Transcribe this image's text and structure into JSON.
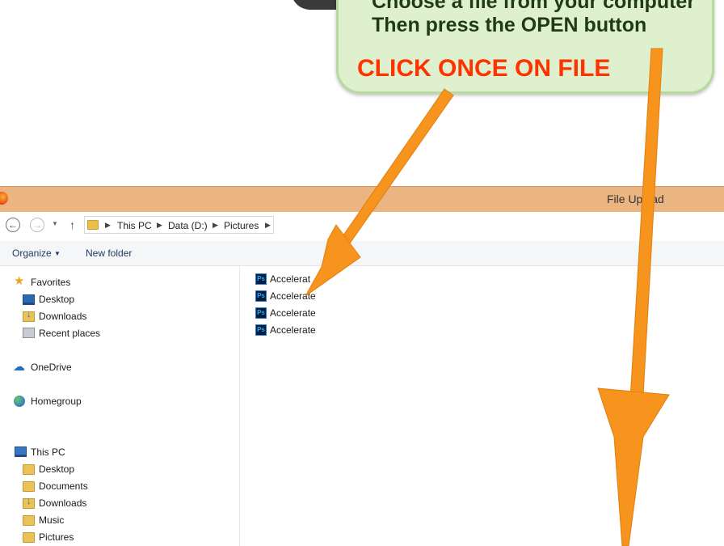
{
  "callout": {
    "line1": "Choose a file from your computer",
    "line2": "Then press the OPEN button",
    "click_text": "CLICK ONCE ON FILE"
  },
  "window": {
    "title": "File Upload"
  },
  "address": {
    "crumbs": [
      "This PC",
      "Data (D:)",
      "Pictures"
    ]
  },
  "toolbar": {
    "organize": "Organize",
    "new_folder": "New folder"
  },
  "nav": {
    "favorites": "Favorites",
    "favorites_items": [
      "Desktop",
      "Downloads",
      "Recent places"
    ],
    "onedrive": "OneDrive",
    "homegroup": "Homegroup",
    "thispc": "This PC",
    "thispc_items": [
      "Desktop",
      "Documents",
      "Downloads",
      "Music",
      "Pictures"
    ]
  },
  "files": [
    "Accelerat",
    "Accelerate",
    "Accelerate",
    "Accelerate"
  ],
  "file_icon_text": "Ps",
  "icons": {
    "back": "back-arrow-icon",
    "forward": "forward-arrow-icon",
    "up": "up-arrow-icon",
    "folder": "folder-icon",
    "star": "star-icon",
    "cloud": "cloud-icon",
    "homegroup": "homegroup-icon",
    "pc": "computer-icon",
    "photoshop": "photoshop-file-icon"
  },
  "colors": {
    "titlebar": "#ebb582",
    "callout_bg": "#dff0cf",
    "callout_text": "#1f3b12",
    "click_text": "#ff3300",
    "arrow": "#f7941d"
  }
}
